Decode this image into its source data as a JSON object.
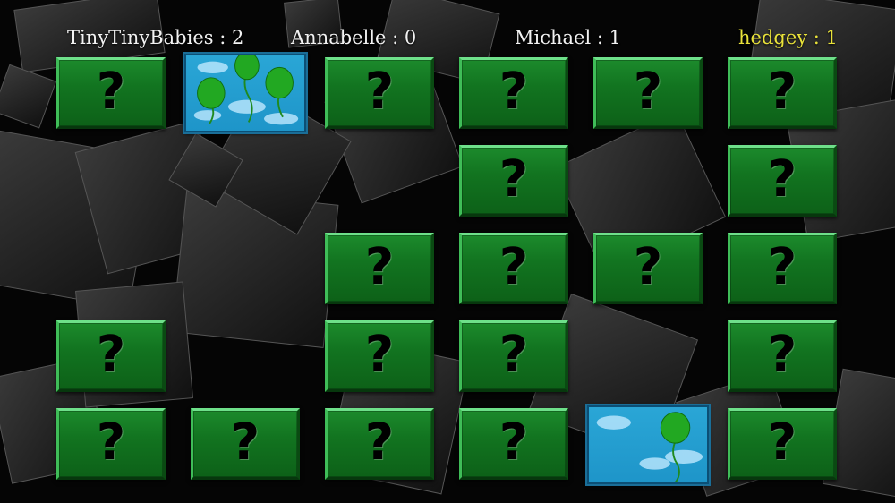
{
  "scoreboard": {
    "players": [
      {
        "name": "TinyTinyBabies",
        "score": "2",
        "text": "TinyTinyBabies : 2",
        "active": false
      },
      {
        "name": "Annabelle",
        "score": "0",
        "text": "Annabelle : 0",
        "active": false
      },
      {
        "name": "Michael",
        "score": "1",
        "text": "Michael : 1",
        "active": false
      },
      {
        "name": "hedgey",
        "score": "1",
        "text": "hedgey : 1",
        "active": true
      }
    ]
  },
  "cards": {
    "hidden_symbol": "?",
    "flipped_image": "green-balloons-sky",
    "colors": {
      "face_down": "#127420",
      "face_up_sky": "#1e95c9",
      "balloon": "#22a822",
      "active_player": "#e9e23a"
    }
  }
}
